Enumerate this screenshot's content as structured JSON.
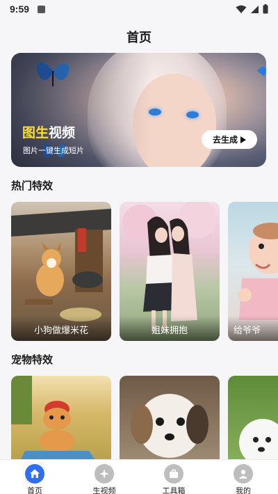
{
  "status_bar": {
    "time": "9:59"
  },
  "page": {
    "title": "首页"
  },
  "banner": {
    "title_highlight": "图生",
    "title_rest": "视频",
    "subtitle": "图片一键生成短片",
    "button_label": "去生成"
  },
  "sections": {
    "hot": {
      "title": "热门特效",
      "cards": [
        {
          "label": "小狗做爆米花"
        },
        {
          "label": "姐妹拥抱"
        },
        {
          "label": "给爷爷"
        }
      ]
    },
    "pet": {
      "title": "宠物特效"
    }
  },
  "tabs": [
    {
      "label": "首页",
      "icon": "home-icon",
      "active": true
    },
    {
      "label": "生视频",
      "icon": "sparkle-icon",
      "active": false
    },
    {
      "label": "工具箱",
      "icon": "toolbox-icon",
      "active": false
    },
    {
      "label": "我的",
      "icon": "user-icon",
      "active": false
    }
  ],
  "colors": {
    "accent": "#2f6ff5",
    "highlight": "#ffe033",
    "inactive_tab": "#bdbdbd"
  }
}
